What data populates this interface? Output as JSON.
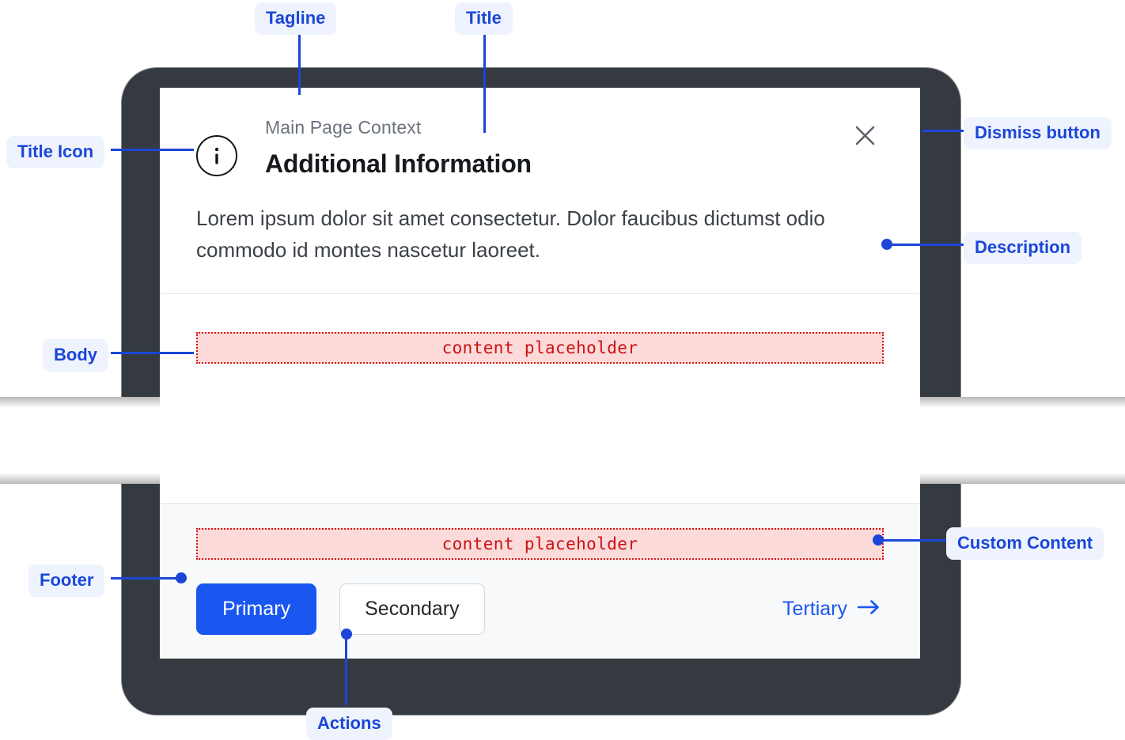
{
  "dialog": {
    "tagline": "Main Page Context",
    "title": "Additional Information",
    "description": "Lorem ipsum dolor sit amet consectetur. Dolor faucibus dictumst odio commodo id montes nascetur laoreet.",
    "title_icon": "info-circle-icon",
    "dismiss_icon": "close-icon",
    "body_placeholder": "content placeholder",
    "footer_placeholder": "content placeholder"
  },
  "footer": {
    "primary_label": "Primary",
    "secondary_label": "Secondary",
    "tertiary_label": "Tertiary",
    "tertiary_icon": "arrow-right-icon"
  },
  "annotations": {
    "tagline": "Tagline",
    "title": "Title",
    "title_icon": "Title Icon",
    "dismiss_button": "Dismiss button",
    "description": "Description",
    "body": "Body",
    "custom_content": "Custom Content",
    "footer": "Footer",
    "actions": "Actions"
  },
  "colors": {
    "accent": "#1a56f0",
    "annotation_text": "#1b46d8",
    "annotation_bg": "#eef3fe",
    "frame": "#343a40",
    "placeholder_bg": "#fcdada",
    "placeholder_border": "#d81414",
    "placeholder_text": "#cc1111",
    "footer_bg": "#f8f9fa",
    "tagline_text": "#6c737f",
    "title_text": "#16191d",
    "description_text": "#3c4149"
  }
}
